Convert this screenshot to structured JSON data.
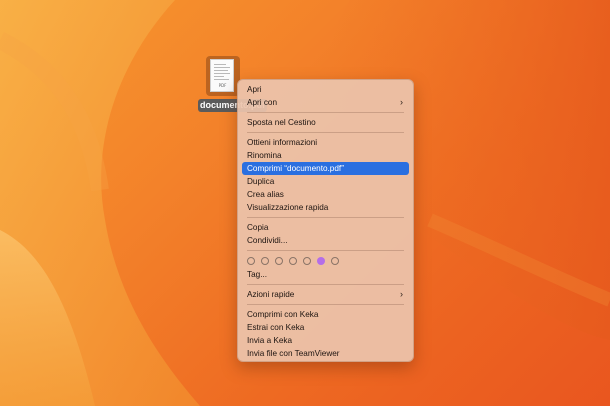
{
  "desktop": {
    "file": {
      "name": "documento.pdf",
      "thumb_label": "PDF",
      "icon": "pdf-document-icon"
    }
  },
  "context_menu": {
    "groups": [
      [
        {
          "label": "Apri",
          "submenu": false
        },
        {
          "label": "Apri con",
          "submenu": true
        }
      ],
      [
        {
          "label": "Sposta nel Cestino",
          "submenu": false
        }
      ],
      [
        {
          "label": "Ottieni informazioni",
          "submenu": false
        },
        {
          "label": "Rinomina",
          "submenu": false
        },
        {
          "label": "Comprimi “documento.pdf”",
          "submenu": false,
          "highlighted": true
        },
        {
          "label": "Duplica",
          "submenu": false
        },
        {
          "label": "Crea alias",
          "submenu": false
        },
        {
          "label": "Visualizzazione rapida",
          "submenu": false
        }
      ],
      [
        {
          "label": "Copia",
          "submenu": false
        },
        {
          "label": "Condividi...",
          "submenu": false
        }
      ]
    ],
    "tag_colors": [
      {
        "name": "tag-color-1",
        "color": "none"
      },
      {
        "name": "tag-color-2",
        "color": "none"
      },
      {
        "name": "tag-color-3",
        "color": "none"
      },
      {
        "name": "tag-color-4",
        "color": "none"
      },
      {
        "name": "tag-color-5",
        "color": "none"
      },
      {
        "name": "tag-color-purple",
        "color": "#b46ee8"
      },
      {
        "name": "tag-color-7",
        "color": "none"
      }
    ],
    "tags_label": "Tag...",
    "quick_actions": {
      "label": "Azioni rapide",
      "submenu": true
    },
    "services": [
      {
        "label": "Comprimi con Keka",
        "submenu": false
      },
      {
        "label": "Estrai con Keka",
        "submenu": false
      },
      {
        "label": "Invia a Keka",
        "submenu": false
      },
      {
        "label": "Invia file con TeamViewer",
        "submenu": false
      }
    ],
    "colors": {
      "highlight": "#2a6fe0",
      "menu_background": "#ecc4ac"
    }
  }
}
